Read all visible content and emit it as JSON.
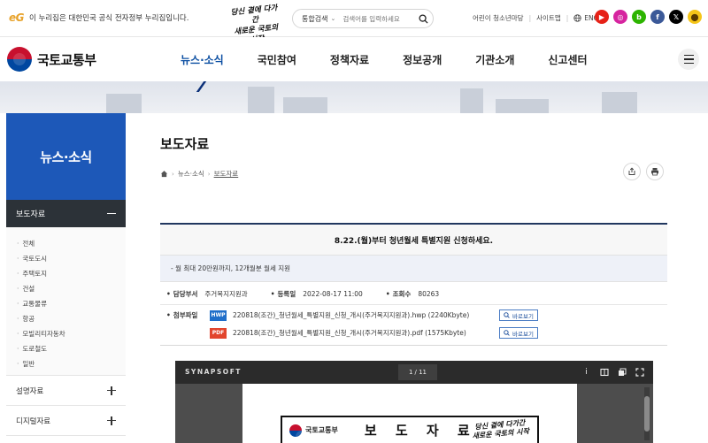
{
  "top": {
    "notice_mark": "eG",
    "notice": "이 누리집은 대한민국 공식 전자정부 누리집입니다.",
    "slogan_line1": "당신 곁에 다가간",
    "slogan_line2": "새로운 국토의 시작",
    "search_category": "통합검색",
    "search_placeholder": "검색어를 입력하세요",
    "links": [
      "어린이 청소년마당",
      "사이트맵",
      "ENG"
    ],
    "sns": [
      {
        "icon": "youtube-icon",
        "color": "#e62117",
        "glyph": "▶"
      },
      {
        "icon": "instagram-icon",
        "color": "#d6249f",
        "glyph": "◎"
      },
      {
        "icon": "blog-icon",
        "color": "#2db400",
        "glyph": "b"
      },
      {
        "icon": "facebook-icon",
        "color": "#3b5998",
        "glyph": "f"
      },
      {
        "icon": "x-icon",
        "color": "#000000",
        "glyph": "𝕏"
      },
      {
        "icon": "kakao-icon",
        "color": "#f5c518",
        "glyph": "⬤"
      }
    ]
  },
  "header": {
    "logo_text": "국토교통부",
    "menu": [
      "뉴스·소식",
      "국민참여",
      "정책자료",
      "정보공개",
      "기관소개",
      "신고센터"
    ],
    "active_index": 0
  },
  "lnb": {
    "title": "뉴스·소식",
    "current": "보도자료",
    "sub_items": [
      "전체",
      "국토도시",
      "주택토지",
      "건설",
      "교통물류",
      "항공",
      "모빌리티자동차",
      "도로철도",
      "일반"
    ],
    "more": [
      "설명자료",
      "디지털자료"
    ]
  },
  "content": {
    "page_title": "보도자료",
    "breadcrumb": [
      "뉴스·소식",
      "보도자료"
    ],
    "article_title": "8.22.(월)부터 청년월세 특별지원 신청하세요.",
    "summary": "- 월 최대 20만원까지, 12개월분 월세 지원",
    "meta": {
      "dept_label": "담당부서",
      "dept": "주거복지지원과",
      "date_label": "등록일",
      "date": "2022-08-17 11:00",
      "views_label": "조회수",
      "views": "80263"
    },
    "attach_label": "첨부파일",
    "files": [
      {
        "type": "HWP",
        "color": "#1f6ec9",
        "name": "220818(조간)_청년월세_특별지원_신청_개시(주거복지지원과).hwp (2240Kbyte)",
        "action": "바로보기"
      },
      {
        "type": "PDF",
        "color": "#e2452d",
        "name": "220818(조간)_청년월세_특별지원_신청_개시(주거복지지원과).pdf (1575Kbyte)",
        "action": "바로보기"
      }
    ]
  },
  "viewer": {
    "brand": "SYNAPSOFT",
    "page_current": "1",
    "page_total": "/ 11",
    "doc_logo": "국토교통부",
    "doc_title": "보 도 자 료",
    "doc_slogan_line1": "당신 곁에 다가간",
    "doc_slogan_line2": "새로운 국토의 시작"
  }
}
